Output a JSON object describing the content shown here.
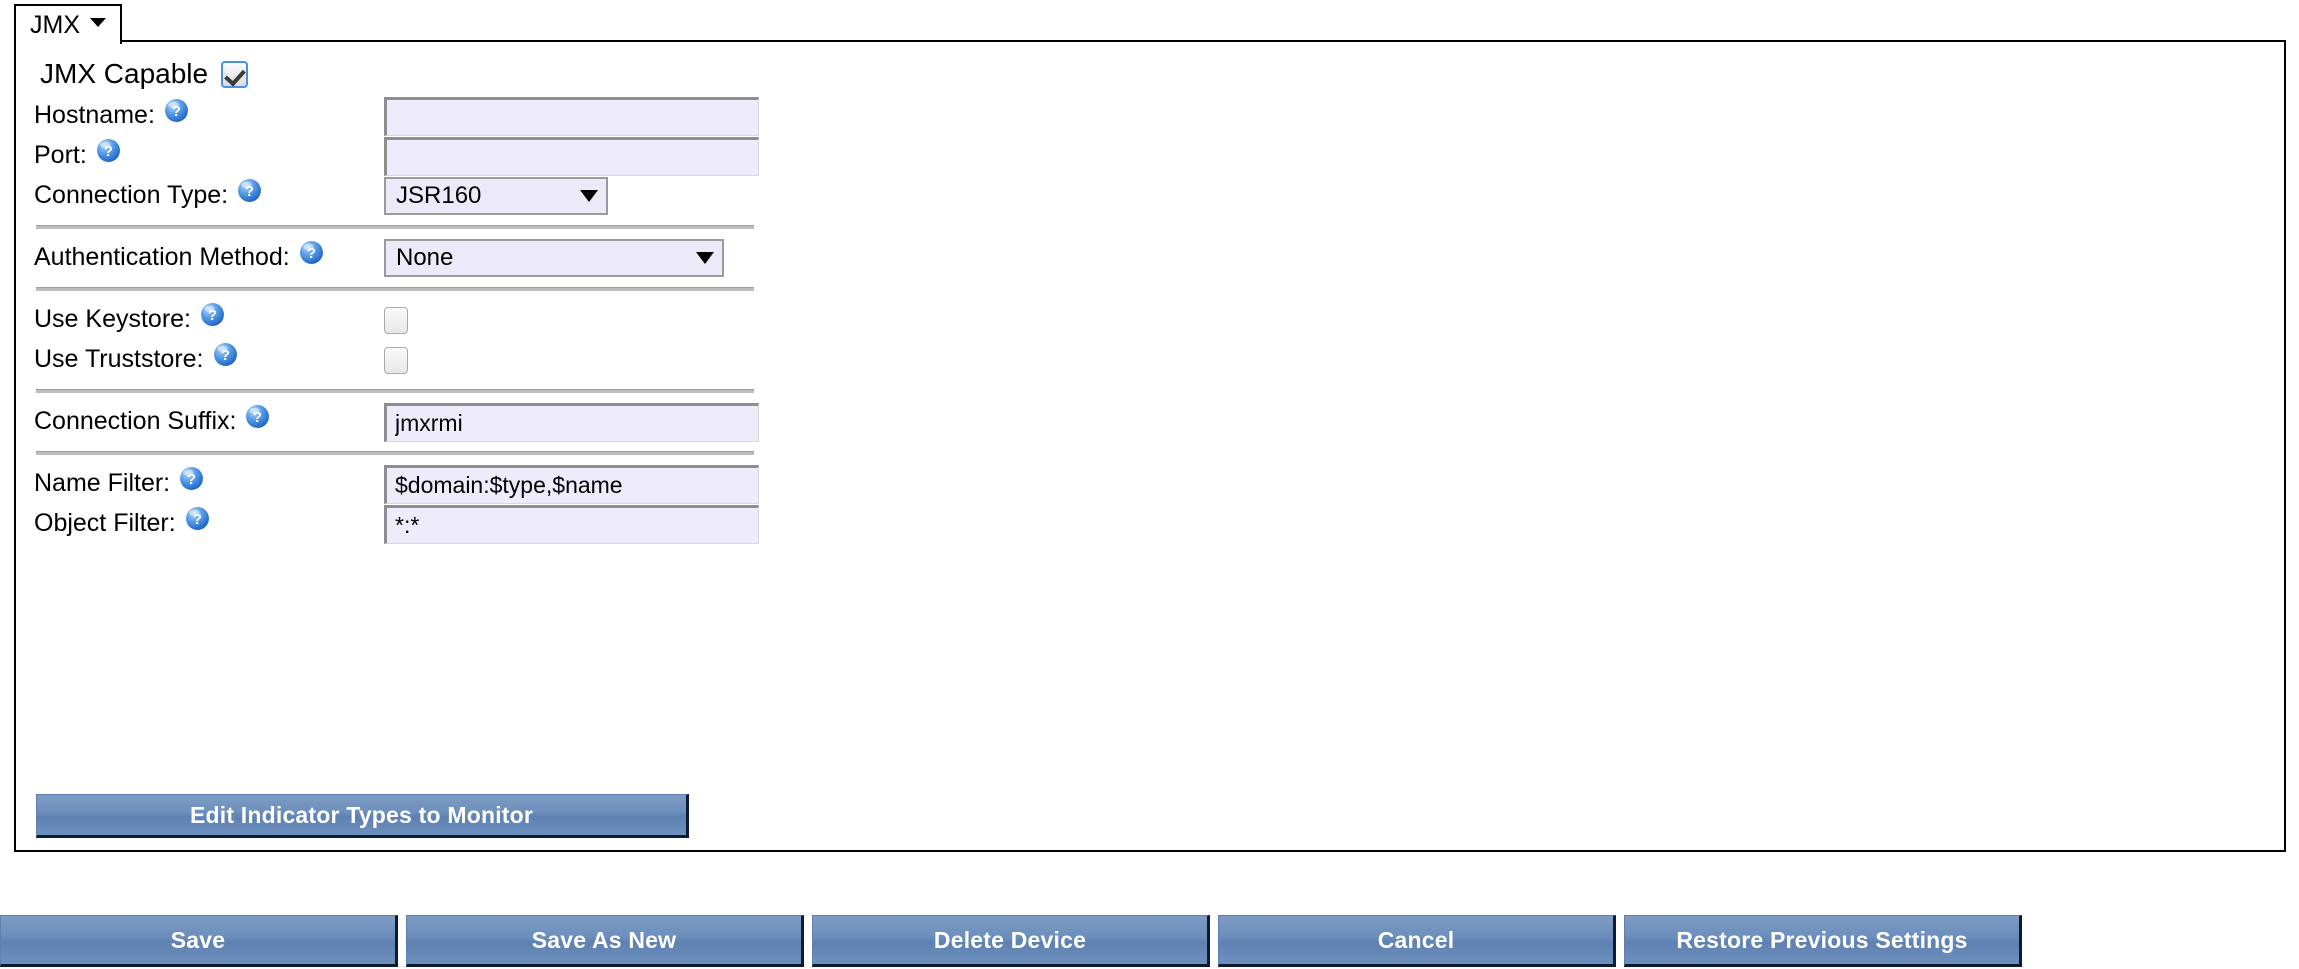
{
  "tab": {
    "label": "JMX",
    "caret_icon": "chevron-down-icon"
  },
  "panel": {
    "capable": {
      "label": "JMX Capable",
      "checked": true
    },
    "fields": [
      {
        "label": "Hostname:",
        "value": "",
        "type": "text"
      },
      {
        "label": "Port:",
        "value": "",
        "type": "text"
      },
      {
        "label": "Connection Type:",
        "value": "JSR160",
        "type": "select"
      },
      {
        "label": "Authentication Method:",
        "value": "None",
        "type": "select"
      },
      {
        "label": "Use Keystore:",
        "value": "",
        "type": "checkbox"
      },
      {
        "label": "Use Truststore:",
        "value": "",
        "type": "checkbox"
      },
      {
        "label": "Connection Suffix:",
        "value": "jmxrmi",
        "type": "text"
      },
      {
        "label": "Name Filter:",
        "value": "$domain:$type,$name",
        "type": "text"
      },
      {
        "label": "Object Filter:",
        "value": "*:*",
        "type": "text"
      }
    ],
    "labels": {
      "hostname": "Hostname:",
      "port": "Port:",
      "connection_type": "Connection Type:",
      "authentication_method": "Authentication Method:",
      "use_keystore": "Use Keystore:",
      "use_truststore": "Use Truststore:",
      "connection_suffix": "Connection Suffix:",
      "name_filter": "Name Filter:",
      "object_filter": "Object Filter:"
    },
    "values": {
      "hostname": "",
      "port": "",
      "connection_type": "JSR160",
      "authentication_method": "None",
      "connection_suffix": "jmxrmi",
      "name_filter": "$domain:$type,$name",
      "object_filter": "*:*"
    },
    "edit_indicator_button": "Edit Indicator Types to Monitor"
  },
  "actions": {
    "save": "Save",
    "save_as_new": "Save As New",
    "delete_device": "Delete Device",
    "cancel": "Cancel",
    "restore_previous_settings": "Restore Previous Settings"
  },
  "colors": {
    "button_blue": "#6d8fbc",
    "button_shadow": "#0f1a33",
    "input_background": "#eeecfb",
    "help_icon_blue": "#4a8fe0",
    "separator": "#bdbdbd",
    "panel_border": "#000000"
  },
  "icons": {
    "help": "help-question-icon",
    "dropdown": "chevron-down-icon",
    "checkbox_checked": "checkmark-icon"
  }
}
